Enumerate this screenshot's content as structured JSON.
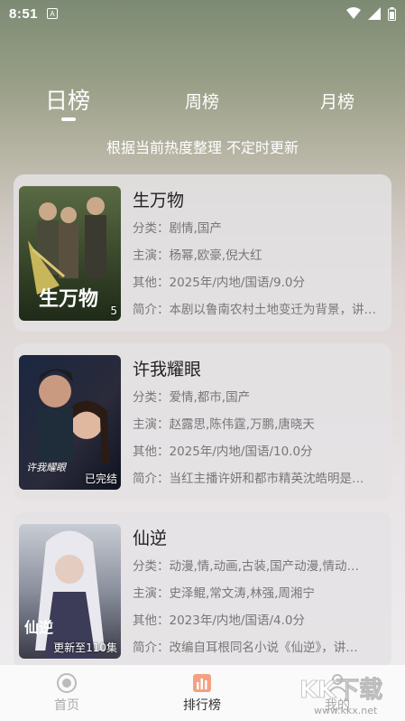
{
  "status": {
    "time": "8:51"
  },
  "tabs": [
    {
      "label": "日榜"
    },
    {
      "label": "周榜"
    },
    {
      "label": "月榜"
    }
  ],
  "subtitle": "根据当前热度整理 不定时更新",
  "items": [
    {
      "title": "生万物",
      "badge": "5",
      "category": "分类：剧情,国产",
      "cast": "主演：杨幂,欧豪,倪大红",
      "other": "其他：2025年/内地/国语/9.0分",
      "intro": "简介：本剧以鲁南农村土地变迁为背景，讲述…",
      "poster_text": "生万物"
    },
    {
      "title": "许我耀眼",
      "badge": "已完结",
      "category": "分类：爱情,都市,国产",
      "cast": "主演：赵露思,陈伟霆,万鹏,唐晓天",
      "other": "其他：2025年/内地/国语/10.0分",
      "intro": "简介：当红主播许妍和都市精英沈皓明是…",
      "poster_text": "许我耀眼"
    },
    {
      "title": "仙逆",
      "badge": "更新至110集",
      "category": "分类：动漫,情,动画,古装,国产动漫,情动…",
      "cast": "主演：史泽鲲,常文涛,林强,周湘宁",
      "other": "其他：2023年/内地/国语/4.0分",
      "intro": "简介：改编自耳根同名小说《仙逆》，讲…",
      "poster_text": "仙逆"
    }
  ],
  "nav": [
    {
      "label": "首页"
    },
    {
      "label": "排行榜"
    },
    {
      "label": "我的"
    }
  ],
  "watermark": {
    "text": "KK下载",
    "url": "www.kkx.net"
  },
  "colors": {
    "accent": "#ffffff",
    "card_bg": "#e4e2e4",
    "nav_active": "#333333"
  }
}
